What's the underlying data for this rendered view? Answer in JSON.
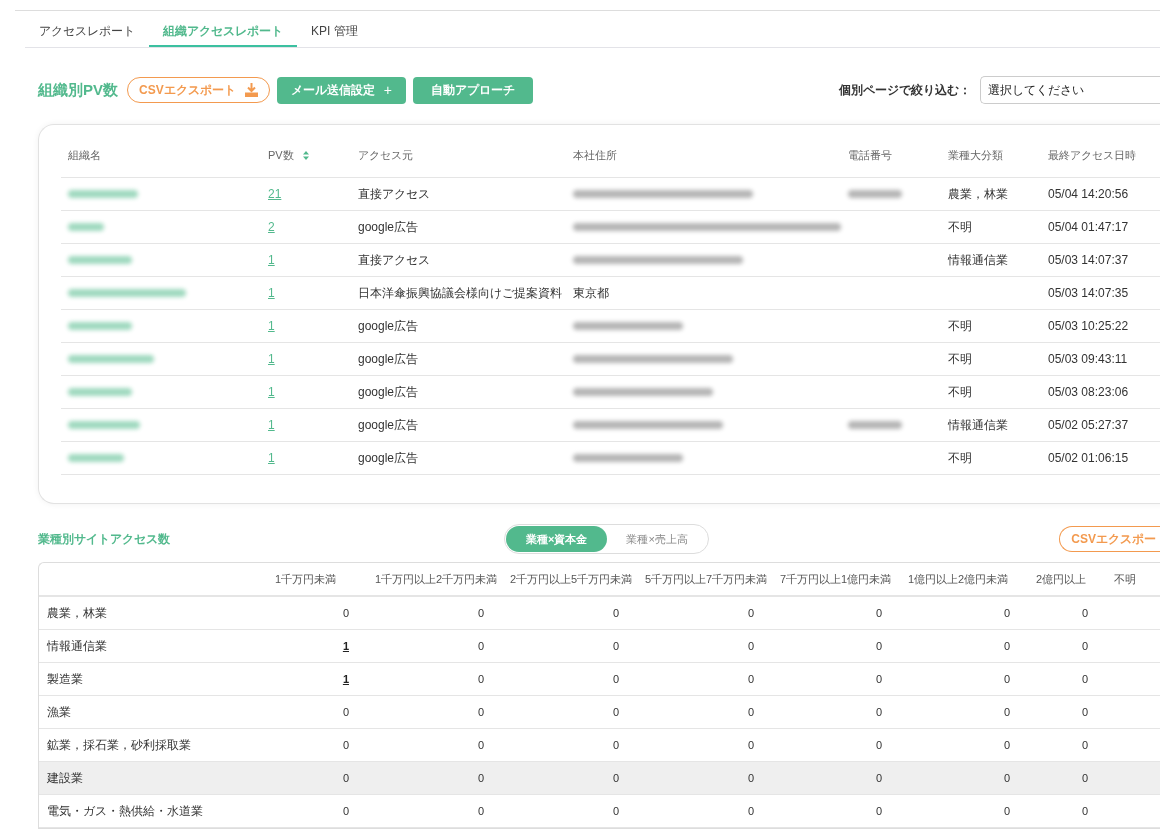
{
  "tabs": [
    {
      "label": "アクセスレポート",
      "selected": false
    },
    {
      "label": "組織アクセスレポート",
      "selected": true
    },
    {
      "label": "KPI 管理",
      "selected": false
    }
  ],
  "pv_section": {
    "title": "組織別PV数",
    "csv_button": "CSVエクスポート",
    "mail_button": "メール送信設定",
    "mail_plus": "+",
    "auto_button": "自動アプローチ",
    "filter_label": "個別ページで絞り込む：",
    "filter_select": {
      "placeholder": "選択してください"
    },
    "columns": [
      "組織名",
      "PV数",
      "アクセス元",
      "本社住所",
      "電話番号",
      "業種大分類",
      "最終アクセス日時"
    ],
    "rows": [
      {
        "name": {
          "kind": "blurred"
        },
        "pv": "21",
        "source": "直接アクセス",
        "address": {
          "kind": "blurred"
        },
        "phone": {
          "kind": "blurred"
        },
        "industry": "農業，林業",
        "last_access": "05/04 14:20:56"
      },
      {
        "name": {
          "kind": "blurred"
        },
        "pv": "2",
        "source": "google広告",
        "address": {
          "kind": "blurred"
        },
        "industry": "不明",
        "last_access": "05/04 01:47:17"
      },
      {
        "name": {
          "kind": "blurred"
        },
        "pv": "1",
        "source": "直接アクセス",
        "address": {
          "kind": "blurred"
        },
        "industry": "情報通信業",
        "last_access": "05/03 14:07:37"
      },
      {
        "name": {
          "kind": "blurred"
        },
        "pv": "1",
        "source": "日本洋傘振興協議会様向けご提案資料",
        "address": {
          "kind": "text",
          "text": "東京都"
        },
        "last_access": "05/03 14:07:35"
      },
      {
        "name": {
          "kind": "blurred"
        },
        "pv": "1",
        "source": "google広告",
        "address": {
          "kind": "blurred"
        },
        "industry": "不明",
        "last_access": "05/03 10:25:22"
      },
      {
        "name": {
          "kind": "blurred"
        },
        "pv": "1",
        "source": "google広告",
        "address": {
          "kind": "blurred"
        },
        "industry": "不明",
        "last_access": "05/03 09:43:11"
      },
      {
        "name": {
          "kind": "blurred"
        },
        "pv": "1",
        "source": "google広告",
        "address": {
          "kind": "blurred"
        },
        "industry": "不明",
        "last_access": "05/03 08:23:06"
      },
      {
        "name": {
          "kind": "blurred"
        },
        "pv": "1",
        "source": "google広告",
        "address": {
          "kind": "blurred"
        },
        "phone": {
          "kind": "blurred"
        },
        "industry": "情報通信業",
        "last_access": "05/02 05:27:37"
      },
      {
        "name": {
          "kind": "blurred"
        },
        "pv": "1",
        "source": "google広告",
        "address": {
          "kind": "blurred"
        },
        "industry": "不明",
        "last_access": "05/02 01:06:15"
      }
    ]
  },
  "industry_section": {
    "title": "業種別サイトアクセス数",
    "toggle": [
      {
        "label": "業種×資本金",
        "selected": true
      },
      {
        "label": "業種×売上高",
        "selected": false
      }
    ],
    "csv_button": "CSVエクスポー",
    "columns": [
      "1千万円未満",
      "1千万円以上2千万円未満",
      "2千万円以上5千万円未満",
      "5千万円以上7千万円未満",
      "7千万円以上1億円未満",
      "1億円以上2億円未満",
      "2億円以上",
      "不明"
    ],
    "rows": [
      {
        "label": "農業，林業",
        "highlighted": false,
        "values": [
          {
            "text": "0",
            "link": false
          },
          {
            "text": "0",
            "link": false
          },
          {
            "text": "0",
            "link": false
          },
          {
            "text": "0",
            "link": false
          },
          {
            "text": "0",
            "link": false
          },
          {
            "text": "0",
            "link": false
          },
          {
            "text": "0",
            "link": false
          }
        ]
      },
      {
        "label": "情報通信業",
        "highlighted": false,
        "values": [
          {
            "text": "1",
            "link": true
          },
          {
            "text": "0",
            "link": false
          },
          {
            "text": "0",
            "link": false
          },
          {
            "text": "0",
            "link": false
          },
          {
            "text": "0",
            "link": false
          },
          {
            "text": "0",
            "link": false
          },
          {
            "text": "0",
            "link": false
          }
        ]
      },
      {
        "label": "製造業",
        "highlighted": false,
        "values": [
          {
            "text": "1",
            "link": true
          },
          {
            "text": "0",
            "link": false
          },
          {
            "text": "0",
            "link": false
          },
          {
            "text": "0",
            "link": false
          },
          {
            "text": "0",
            "link": false
          },
          {
            "text": "0",
            "link": false
          },
          {
            "text": "0",
            "link": false
          }
        ]
      },
      {
        "label": "漁業",
        "highlighted": false,
        "values": [
          {
            "text": "0",
            "link": false
          },
          {
            "text": "0",
            "link": false
          },
          {
            "text": "0",
            "link": false
          },
          {
            "text": "0",
            "link": false
          },
          {
            "text": "0",
            "link": false
          },
          {
            "text": "0",
            "link": false
          },
          {
            "text": "0",
            "link": false
          }
        ]
      },
      {
        "label": "鉱業，採石業，砂利採取業",
        "highlighted": false,
        "values": [
          {
            "text": "0",
            "link": false
          },
          {
            "text": "0",
            "link": false
          },
          {
            "text": "0",
            "link": false
          },
          {
            "text": "0",
            "link": false
          },
          {
            "text": "0",
            "link": false
          },
          {
            "text": "0",
            "link": false
          },
          {
            "text": "0",
            "link": false
          }
        ]
      },
      {
        "label": "建設業",
        "highlighted": true,
        "values": [
          {
            "text": "0",
            "link": false
          },
          {
            "text": "0",
            "link": false
          },
          {
            "text": "0",
            "link": false
          },
          {
            "text": "0",
            "link": false
          },
          {
            "text": "0",
            "link": false
          },
          {
            "text": "0",
            "link": false
          },
          {
            "text": "0",
            "link": false
          }
        ]
      },
      {
        "label": "電気・ガス・熱供給・水道業",
        "highlighted": false,
        "values": [
          {
            "text": "0",
            "link": false
          },
          {
            "text": "0",
            "link": false
          },
          {
            "text": "0",
            "link": false
          },
          {
            "text": "0",
            "link": false
          },
          {
            "text": "0",
            "link": false
          },
          {
            "text": "0",
            "link": false
          },
          {
            "text": "0",
            "link": false
          }
        ]
      }
    ]
  }
}
